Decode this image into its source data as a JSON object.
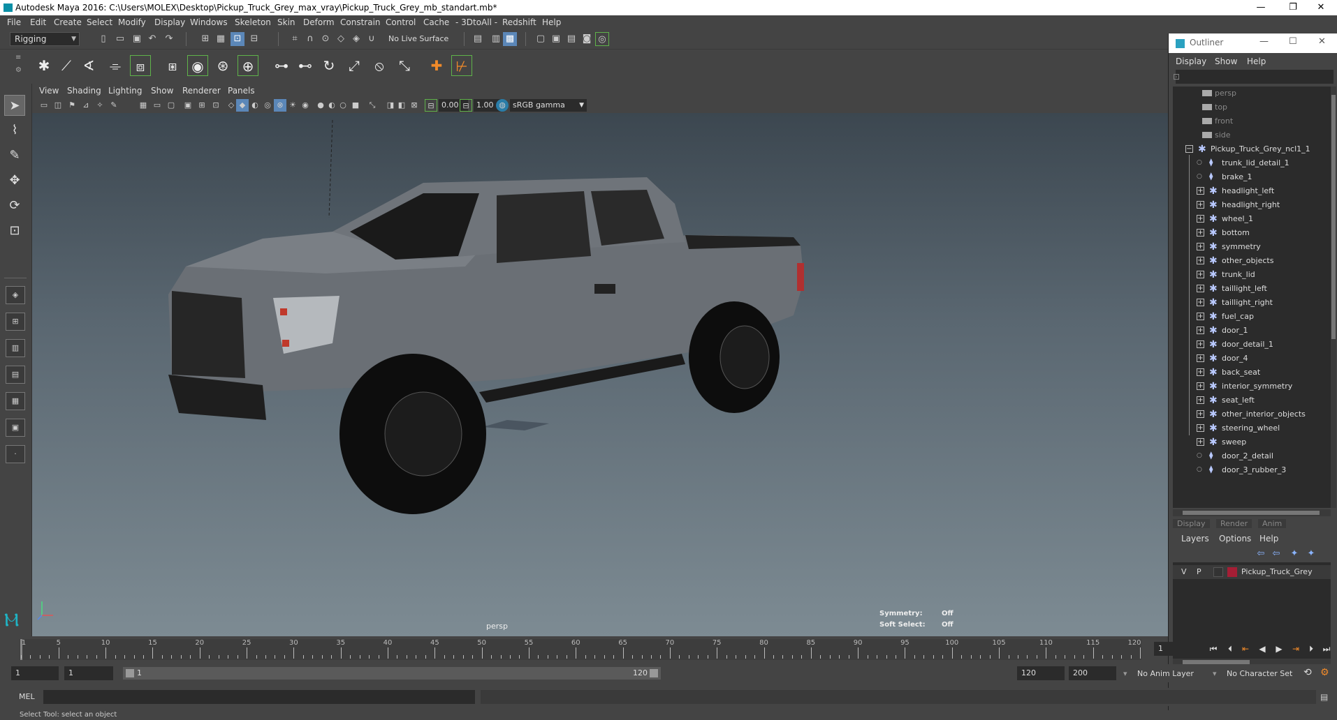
{
  "window": {
    "title": "Autodesk Maya 2016: C:\\Users\\MOLEX\\Desktop\\Pickup_Truck_Grey_max_vray\\Pickup_Truck_Grey_mb_standart.mb*",
    "minimize": "—",
    "restore": "❐",
    "close": "✕"
  },
  "menubar": [
    "File",
    "Edit",
    "Create",
    "Select",
    "Modify",
    "Display",
    "Windows",
    "Skeleton",
    "Skin",
    "Deform",
    "Constrain",
    "Control",
    "Cache",
    "- 3DtoAll -",
    "Redshift",
    "Help"
  ],
  "status": {
    "menuset": "Rigging",
    "live_surface": "No Live Surface"
  },
  "viewport": {
    "menu": [
      "View",
      "Shading",
      "Lighting",
      "Show",
      "Renderer",
      "Panels"
    ],
    "exposure": "0.00",
    "gamma": "1.00",
    "colorspace": "sRGB gamma",
    "camera_label": "persp",
    "symmetry_label": "Symmetry:",
    "symmetry_value": "Off",
    "soft_select_label": "Soft Select:",
    "soft_select_value": "Off"
  },
  "outliner": {
    "title": "Outliner",
    "menu": [
      "Display",
      "Show",
      "Help"
    ],
    "cameras": [
      "persp",
      "top",
      "front",
      "side"
    ],
    "root": "Pickup_Truck_Grey_ncl1_1",
    "children": [
      {
        "name": "trunk_lid_detail_1",
        "expandable": false
      },
      {
        "name": "brake_1",
        "expandable": false
      },
      {
        "name": "headlight_left",
        "expandable": true
      },
      {
        "name": "headlight_right",
        "expandable": true
      },
      {
        "name": "wheel_1",
        "expandable": true
      },
      {
        "name": "bottom",
        "expandable": true
      },
      {
        "name": "symmetry",
        "expandable": true
      },
      {
        "name": "other_objects",
        "expandable": true
      },
      {
        "name": "trunk_lid",
        "expandable": true
      },
      {
        "name": "taillight_left",
        "expandable": true
      },
      {
        "name": "taillight_right",
        "expandable": true
      },
      {
        "name": "fuel_cap",
        "expandable": true
      },
      {
        "name": "door_1",
        "expandable": true
      },
      {
        "name": "door_detail_1",
        "expandable": true
      },
      {
        "name": "door_4",
        "expandable": true
      },
      {
        "name": "back_seat",
        "expandable": true
      },
      {
        "name": "interior_symmetry",
        "expandable": true
      },
      {
        "name": "seat_left",
        "expandable": true
      },
      {
        "name": "other_interior_objects",
        "expandable": true
      },
      {
        "name": "steering_wheel",
        "expandable": true
      },
      {
        "name": "sweep",
        "expandable": true
      },
      {
        "name": "door_2_detail",
        "expandable": false
      },
      {
        "name": "door_3_rubber_3",
        "expandable": false
      }
    ]
  },
  "layers": {
    "tabs": [
      "Display",
      "Render",
      "Anim"
    ],
    "menu": [
      "Layers",
      "Options",
      "Help"
    ],
    "rows": [
      {
        "v": "V",
        "p": "P",
        "name": "Pickup_Truck_Grey",
        "color": "#a51e35"
      }
    ]
  },
  "timeline": {
    "start": 1,
    "end": 120,
    "labels": [
      1,
      5,
      10,
      15,
      20,
      25,
      30,
      35,
      40,
      45,
      50,
      55,
      60,
      65,
      70,
      75,
      80,
      85,
      90,
      95,
      100,
      105,
      110,
      115,
      120
    ],
    "current_frame": "1"
  },
  "range": {
    "start_frame": "1",
    "playback_start": "1",
    "range_start": "1",
    "range_end": "120",
    "playback_end": "120",
    "end_frame": "200",
    "anim_layer": "No Anim Layer",
    "character_set": "No Character Set"
  },
  "command": {
    "label": "MEL",
    "help": "Select Tool: select an object"
  }
}
